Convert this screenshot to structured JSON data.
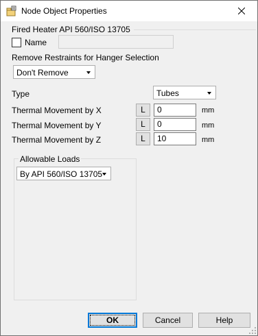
{
  "window": {
    "title": "Node Object Properties",
    "icon": "properties-icon"
  },
  "section": {
    "title": "Fired Heater API 560/ISO 13705"
  },
  "name": {
    "label": "Name",
    "checked": false,
    "value": ""
  },
  "restraints": {
    "label": "Remove Restraints for Hanger Selection",
    "selected": "Don't Remove"
  },
  "type": {
    "label": "Type",
    "selected": "Tubes"
  },
  "thermal": [
    {
      "label": "Thermal Movement by X",
      "button": "L",
      "value": "0",
      "unit": "mm"
    },
    {
      "label": "Thermal Movement by Y",
      "button": "L",
      "value": "0",
      "unit": "mm"
    },
    {
      "label": "Thermal Movement by Z",
      "button": "L",
      "value": "10",
      "unit": "mm"
    }
  ],
  "allowable_loads": {
    "title": "Allowable Loads",
    "selected": "By API 560/ISO 13705"
  },
  "buttons": {
    "ok": "OK",
    "cancel": "Cancel",
    "help": "Help"
  }
}
